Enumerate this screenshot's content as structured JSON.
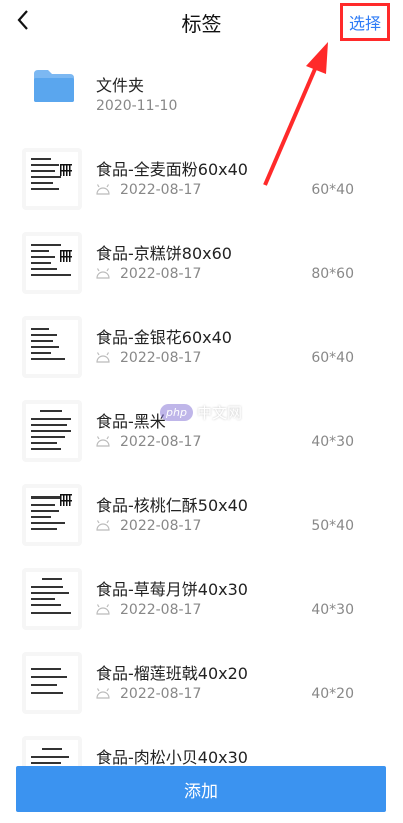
{
  "header": {
    "title": "标签",
    "select_label": "选择"
  },
  "folder": {
    "name": "文件夹",
    "date": "2020-11-10"
  },
  "items": [
    {
      "name": "食品-全麦面粉60x40",
      "date": "2022-08-17",
      "size": "60*40"
    },
    {
      "name": "食品-京糕饼80x60",
      "date": "2022-08-17",
      "size": "80*60"
    },
    {
      "name": "食品-金银花60x40",
      "date": "2022-08-17",
      "size": "60*40"
    },
    {
      "name": "食品-黑米",
      "date": "2022-08-17",
      "size": "40*30"
    },
    {
      "name": "食品-核桃仁酥50x40",
      "date": "2022-08-17",
      "size": "50*40"
    },
    {
      "name": "食品-草莓月饼40x30",
      "date": "2022-08-17",
      "size": "40*30"
    },
    {
      "name": "食品-榴莲班戟40x20",
      "date": "2022-08-17",
      "size": "40*20"
    },
    {
      "name": "食品-肉松小贝40x30",
      "date": "",
      "size": ""
    }
  ],
  "watermark": {
    "badge": "php",
    "text": "中文网"
  },
  "footer": {
    "add_label": "添加"
  },
  "colors": {
    "accent": "#3b93f0",
    "select_text": "#2f7cf6",
    "highlight": "#ff2a2a"
  }
}
